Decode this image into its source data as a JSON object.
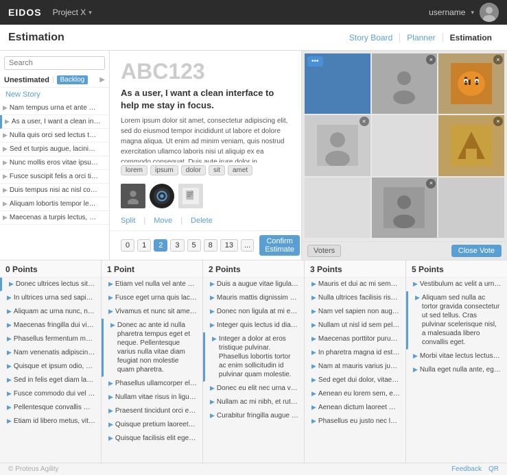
{
  "topnav": {
    "logo": "EIDOS",
    "project": "Project X",
    "username": "username"
  },
  "subnav": {
    "title": "Estimation",
    "links": [
      {
        "label": "Story Board",
        "active": false
      },
      {
        "label": "Planner",
        "active": false
      },
      {
        "label": "Estimation",
        "active": true
      }
    ]
  },
  "sidebar": {
    "search_placeholder": "Search",
    "tab_unestimated": "Unestimated",
    "tab_backlog": "Backlog",
    "new_story": "New Story",
    "items": [
      {
        "text": "Nam tempus urna et ante hendrer"
      },
      {
        "text": "As a user, I want a clean interface",
        "highlighted": true
      },
      {
        "text": "Nulla quis orci sed lectus tempus"
      },
      {
        "text": "Sed et turpis augue, lacinia posue"
      },
      {
        "text": "Nunc mollis eros vitae ipsum cong"
      },
      {
        "text": "Fusce suscipit felis a orci tincidunt"
      },
      {
        "text": "Duis tempus nisi ac nisl convallis v"
      },
      {
        "text": "Aliquam lobortis tempor lectus, ut"
      },
      {
        "text": "Maecenas a turpis lectus, vitae he"
      }
    ]
  },
  "story": {
    "id": "ABC123",
    "desc": "As a user, I want a clean interface to help me stay in focus.",
    "body": "Lorem ipsum dolor sit amet, consectetur adipiscing elit, sed do eiusmod tempor incididunt ut labore et dolore magna aliqua. Ut enim ad minim veniam, quis nostrud exercitation ullamco laboris nisi ut aliquip ex ea commodo consequat. Duis aute irure dolor in reprehenderit in voluptate velit esse cillum dolore eu fugiat nulla pariatur. Excepteur sint occaecat cupidatat non proident, sunt in culpa qui officia deserunt mollit anim id est laborum.",
    "tags": [
      "lorem",
      "ipsum",
      "dolor",
      "sit",
      "amet"
    ],
    "actions": {
      "split": "Split",
      "move": "Move",
      "delete": "Delete"
    },
    "estimates": [
      "0",
      "1",
      "2",
      "3",
      "5",
      "8",
      "13",
      "..."
    ],
    "active_estimate": "2",
    "confirm_label": "Confirm Estimate",
    "voters_label": "Voters",
    "close_vote_label": "Close Vote"
  },
  "columns": [
    {
      "label": "0 Points",
      "items": [
        "Donec ultrices lectus sit amet mi",
        "In ultrices urna sed sapien matta",
        "Aliquam ac urna nunc, non varius",
        "Maecenas fringilla dui vitae semb",
        "Phasellus fermentum metus lobort",
        "Nam venenatis adipiscing augue s",
        "Quisque et ipsum odio, sed vehic",
        "Sed in felis eget diam laoreet tinc",
        "Fusce commodo dui vel est lacinia",
        "Pellentesque convallis malesuad",
        "Etiam id libero metus, vitae faucib"
      ]
    },
    {
      "label": "1 Point",
      "items": [
        "Etiam vel nulla vel ante sodales lo",
        "Fusce eget urna quis lacus accum",
        "Vivamus et nunc sit amet turpis pr",
        "Donec ac ante id nulla pharetra tempus eget et neque. Pellentesque varius nulla vitae diam feugiat non molestie quam pharetra.",
        "Phasellus ullamcorper elit eget ant",
        "Nullam vitae risus in ligula blandit",
        "Praesent tincidunt orci eu massa f",
        "Quisque pretium laoreet lacus, sit",
        "Quisque facilisis elit eget neque el"
      ]
    },
    {
      "label": "2 Points",
      "items": [
        "Duis a augue vitae ligula condimer",
        "Mauris mattis dignissim tellus, sod",
        "Donec non ligula at mi euismod he",
        "Integer quis lectus id diam gravida",
        "Integer a dolor at eros tristique pulvinar. Phasellus lobortis tortor ac enim sollicitudin id pulvinar quam molestie.",
        "Donec eu elit nec urna viverra mal",
        "Nullam ac mi nibh, et rutrum lorem",
        "Curabitur fringilla augue eu purus"
      ]
    },
    {
      "label": "3 Points",
      "items": [
        "Mauris et dui ac mi semper egesta",
        "Nulla ultrices facilisis risus, et lacir",
        "Nam vel sapien non augue auctor",
        "Nullam ut nisl id sem pellentesque",
        "Maecenas porttitor purus non met",
        "In pharetra magna id est condimer",
        "Nam at mauris varius justo consec",
        "Sed eget dui dolor, vitae volutpat f",
        "Aenean eu lorem sem, et accumse",
        "Aenean dictum laoreet massa, fau",
        "Phasellus eu justo nec lacus cursu"
      ]
    },
    {
      "label": "5 Points",
      "items": [
        "Vestibulum ac velit a urna varius v",
        "Aliquam sed nulla ac tortor gravida consectetur ut sed tellus. Cras pulvinar scelerisque nisl, a malesuada libero convallis eget.",
        "Morbi vitae lectus lectus, at sodal",
        "Nulla eget nulla ante, eget imperd"
      ]
    }
  ],
  "footer": {
    "copyright": "© Proteus Agility",
    "links": [
      "Feedback",
      "QR"
    ]
  }
}
